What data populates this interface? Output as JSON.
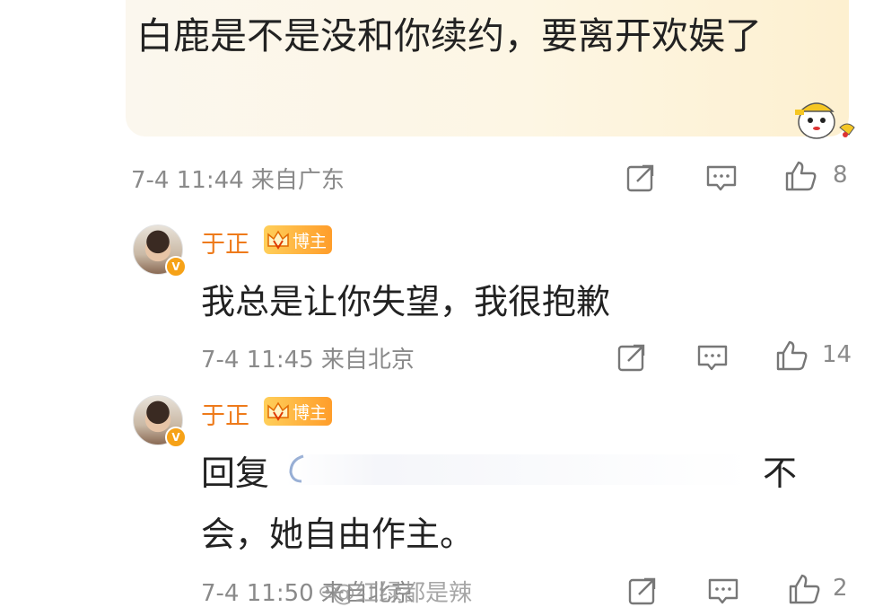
{
  "top_comment": {
    "text": "白鹿是不是没和你续约，要离开欢娱了",
    "meta": "7-4 11:44 来自广东",
    "likes": "8",
    "card_colors": [
      "#fbf7ee",
      "#fdf0d0"
    ]
  },
  "replies": [
    {
      "username": "于正",
      "badge": "博主",
      "text": "我总是让你失望，我很抱歉",
      "meta": "7-4 11:45 来自北京",
      "likes": "14"
    },
    {
      "username": "于正",
      "badge": "博主",
      "text_line1_prefix": "回复",
      "text_line1_suffix": "不",
      "text_line2": "会，她自由作主。",
      "meta": "7-4 11:50 来自北京",
      "likes": "2"
    }
  ],
  "watermark": "@红绿都是辣",
  "icons": {
    "repost": "repost-icon",
    "comment": "comment-icon",
    "like": "like-icon",
    "verified": "v-badge-icon"
  },
  "colors": {
    "username": "#ee7a1a",
    "meta": "#8a8a8a",
    "badge": "#ff9d2a"
  }
}
